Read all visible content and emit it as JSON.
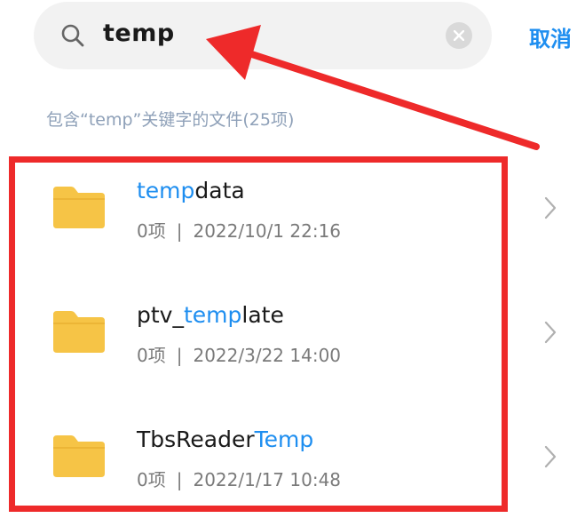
{
  "search": {
    "query": "temp",
    "cancel_label": "取消"
  },
  "result_info": "包含“temp”关键字的文件(25项)",
  "files": [
    {
      "name_prefix": "",
      "name_match": "temp",
      "name_suffix": "data",
      "count": "0项",
      "separator": "|",
      "date": "2022/10/1 22:16"
    },
    {
      "name_prefix": "ptv_",
      "name_match": "temp",
      "name_suffix": "late",
      "count": "0项",
      "separator": "|",
      "date": "2022/3/22 14:00"
    },
    {
      "name_prefix": "TbsReader",
      "name_match": "Temp",
      "name_suffix": "",
      "count": "0项",
      "separator": "|",
      "date": "2022/1/17 10:48"
    }
  ],
  "colors": {
    "accent": "#1e8ef0",
    "folder": "#f6c446",
    "annotation": "#ee2a2a"
  },
  "icons": [
    "search-icon",
    "clear-icon",
    "folder-icon",
    "chevron-right-icon"
  ]
}
